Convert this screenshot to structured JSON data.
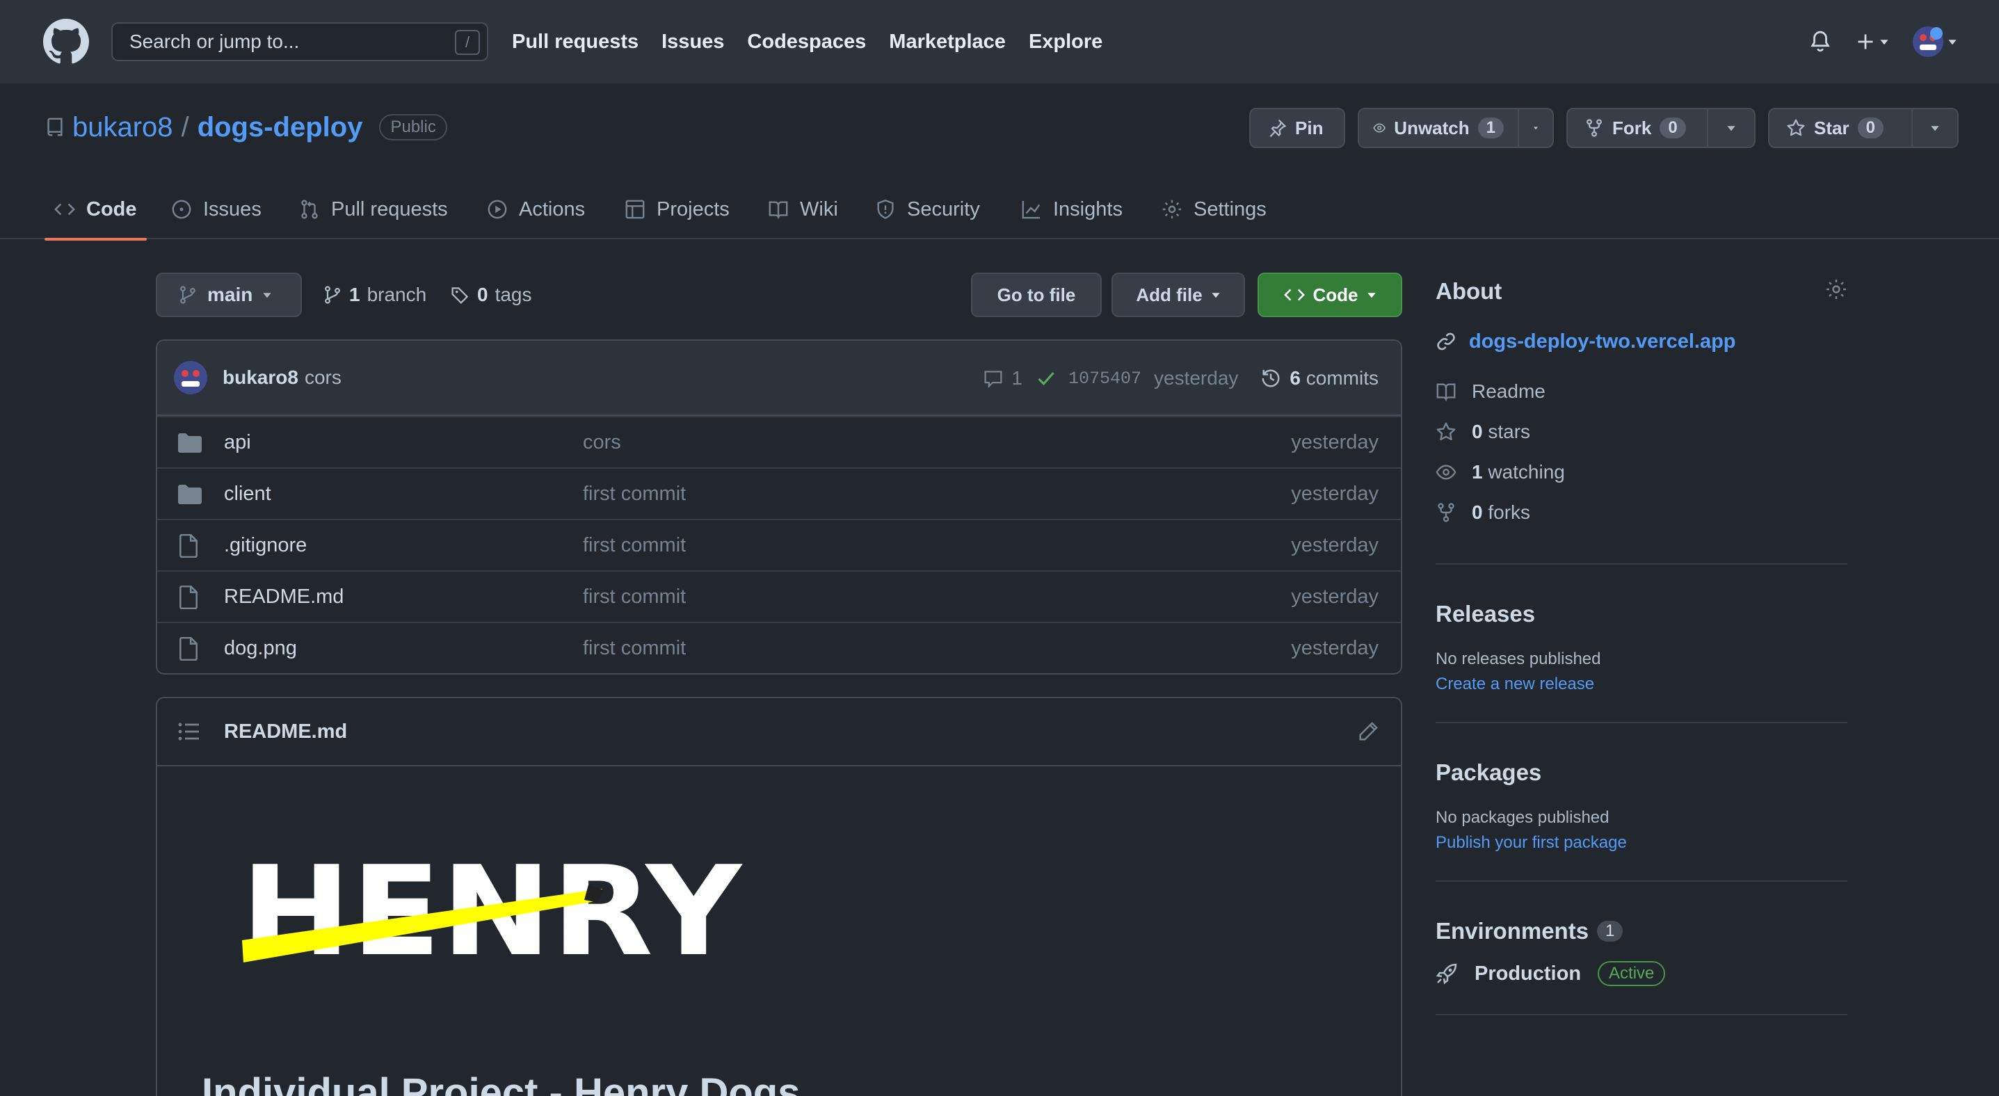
{
  "header": {
    "search_placeholder": "Search or jump to...",
    "search_key": "/",
    "nav": [
      "Pull requests",
      "Issues",
      "Codespaces",
      "Marketplace",
      "Explore"
    ]
  },
  "repo": {
    "owner": "bukaro8",
    "separator": "/",
    "name": "dogs-deploy",
    "visibility": "Public",
    "pin_label": "Pin",
    "watch_label": "Unwatch",
    "watch_count": "1",
    "fork_label": "Fork",
    "fork_count": "0",
    "star_label": "Star",
    "star_count": "0"
  },
  "tabs": [
    "Code",
    "Issues",
    "Pull requests",
    "Actions",
    "Projects",
    "Wiki",
    "Security",
    "Insights",
    "Settings"
  ],
  "file_nav": {
    "branch": "main",
    "branch_count": "1",
    "branch_label": "branch",
    "tag_count": "0",
    "tag_label": "tags",
    "go_to_file": "Go to file",
    "add_file": "Add file",
    "code": "Code"
  },
  "commit": {
    "author": "bukaro8",
    "message": "cors",
    "comments": "1",
    "sha": "1075407",
    "time": "yesterday",
    "commit_count": "6",
    "commit_label": "commits"
  },
  "files": [
    {
      "name": "api",
      "type": "dir",
      "commit": "cors",
      "age": "yesterday"
    },
    {
      "name": "client",
      "type": "dir",
      "commit": "first commit",
      "age": "yesterday"
    },
    {
      "name": ".gitignore",
      "type": "file",
      "commit": "first commit",
      "age": "yesterday"
    },
    {
      "name": "README.md",
      "type": "file",
      "commit": "first commit",
      "age": "yesterday"
    },
    {
      "name": "dog.png",
      "type": "file",
      "commit": "first commit",
      "age": "yesterday"
    }
  ],
  "readme": {
    "filename": "README.md",
    "logo_text": "HENRY",
    "heading": "Individual Project - Henry Dogs"
  },
  "sidebar": {
    "about_title": "About",
    "website": "dogs-deploy-two.vercel.app",
    "readme": "Readme",
    "stars_count": "0",
    "stars_label": "stars",
    "watching_count": "1",
    "watching_label": "watching",
    "forks_count": "0",
    "forks_label": "forks",
    "releases_title": "Releases",
    "releases_none": "No releases published",
    "releases_link": "Create a new release",
    "packages_title": "Packages",
    "packages_none": "No packages published",
    "packages_link": "Publish your first package",
    "env_title": "Environments",
    "env_count": "1",
    "env_name": "Production",
    "env_status": "Active"
  },
  "colors": {
    "background": "#22272e",
    "header": "#2d333b",
    "link": "#539bf5",
    "green_button": "#347d39",
    "tab_underline": "#ec775c",
    "henry_yellow": "#ffff01"
  }
}
